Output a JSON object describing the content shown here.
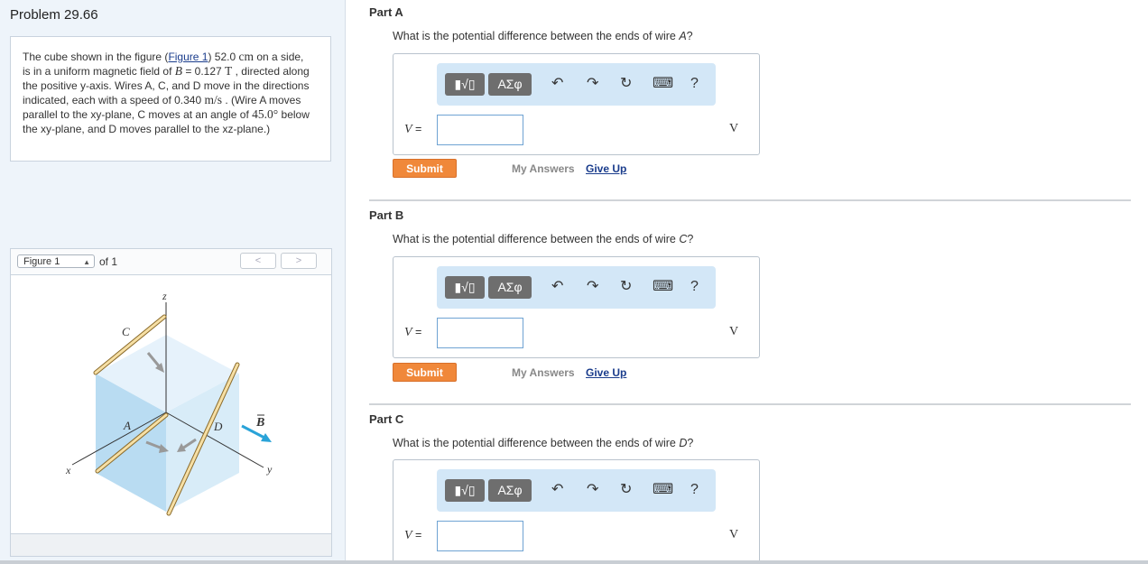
{
  "problem": {
    "title": "Problem 29.66",
    "text_1": "The cube shown in the figure (",
    "figure_link": "Figure 1",
    "text_2": ") 52.0 ",
    "unit_cm": "cm",
    "text_3": " on a side, is in a uniform magnetic field of ",
    "var_B": "B",
    "text_4": " = 0.127 ",
    "unit_T": "T",
    "text_5": " , directed along the positive y-axis. Wires A, C, and D move in the directions indicated, each with a speed of 0.340 ",
    "unit_ms": "m/s",
    "text_6": " . (Wire A moves parallel to the xy-plane, C moves at an angle of ",
    "angle": "45.0°",
    "text_7": " below the xy-plane, and D moves parallel to the xz-plane.)"
  },
  "figure": {
    "select_label": "Figure 1",
    "of_label": "of 1",
    "prev": "<",
    "next": ">",
    "label_z": "z",
    "label_y": "y",
    "label_x": "x",
    "label_C": "C",
    "label_A": "A",
    "label_D": "D",
    "label_B": "B"
  },
  "toolbar": {
    "templates": "▮√▯",
    "greek": "ΑΣφ",
    "undo": "↶",
    "redo": "↷",
    "reset": "↻",
    "keyboard": "⌨",
    "help": "?"
  },
  "parts": [
    {
      "title": "Part A",
      "question_1": "What is the potential difference between the ends of wire ",
      "wire": "A",
      "question_2": "?",
      "var_label": "V",
      "equals": "=",
      "unit": "V",
      "submit": "Submit",
      "my_answers": "My Answers",
      "give_up": "Give Up"
    },
    {
      "title": "Part B",
      "question_1": "What is the potential difference between the ends of wire ",
      "wire": "C",
      "question_2": "?",
      "var_label": "V",
      "equals": "=",
      "unit": "V",
      "submit": "Submit",
      "my_answers": "My Answers",
      "give_up": "Give Up"
    },
    {
      "title": "Part C",
      "question_1": "What is the potential difference between the ends of wire ",
      "wire": "D",
      "question_2": "?",
      "var_label": "V",
      "equals": "=",
      "unit": "V"
    }
  ],
  "colors": {
    "submit": "#f0883a",
    "link": "#1a3c8c",
    "toolbar_bg": "#d3e7f7",
    "left_bg": "#eef4fa",
    "field_arrow": "#2aa3d8"
  }
}
